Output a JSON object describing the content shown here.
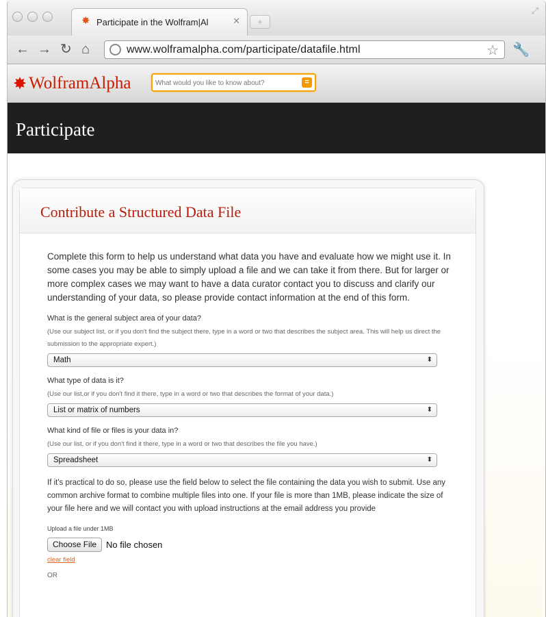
{
  "browser": {
    "tab_title": "Participate in the Wolfram|Al",
    "url": "www.wolframalpha.com/participate/datafile.html"
  },
  "site": {
    "logo_text": "WolframAlpha",
    "search_placeholder": "What would you like to know about?"
  },
  "banner": {
    "title": "Participate"
  },
  "card": {
    "title": "Contribute a Structured Data File",
    "intro": "Complete this form to help us understand what data you have and evaluate how we might use it. In some cases you may be able to simply upload a file and we can take it from there. But for larger or more complex cases we may want to have a data curator contact you to discuss and clarify our understanding of your data, so please provide contact information at the end of this form."
  },
  "questions": [
    {
      "label": "What is the general subject area of your data?",
      "hint": "(Use our subject list, or if you don't find the subject there, type in a word or two that describes the subject area. This will help us direct the submission to the appropriate expert.)",
      "selected": "Math"
    },
    {
      "label": "What type of data is it?",
      "hint": "(Use our list,or if you don't find it there, type in a word or two that describes the format of your data.)",
      "selected": "List or matrix of numbers"
    },
    {
      "label": "What kind of file or files is your data in?",
      "hint": "(Use our list, or if you don't find it there, type in a word or two that describes the file you have.)",
      "selected": "Spreadsheet"
    }
  ],
  "upload": {
    "instructions": "If it's practical to do so, please use the field below to select the file containing the data you wish to submit. Use any common archive format to combine multiple files into one. If your file is more than 1MB, please indicate the size of your file here and we will contact you with upload instructions at the email address you provide",
    "label": "Upload a file under 1MB",
    "button_label": "Choose File",
    "status": "No file chosen",
    "clear_label": "clear field",
    "or_text": "OR"
  }
}
